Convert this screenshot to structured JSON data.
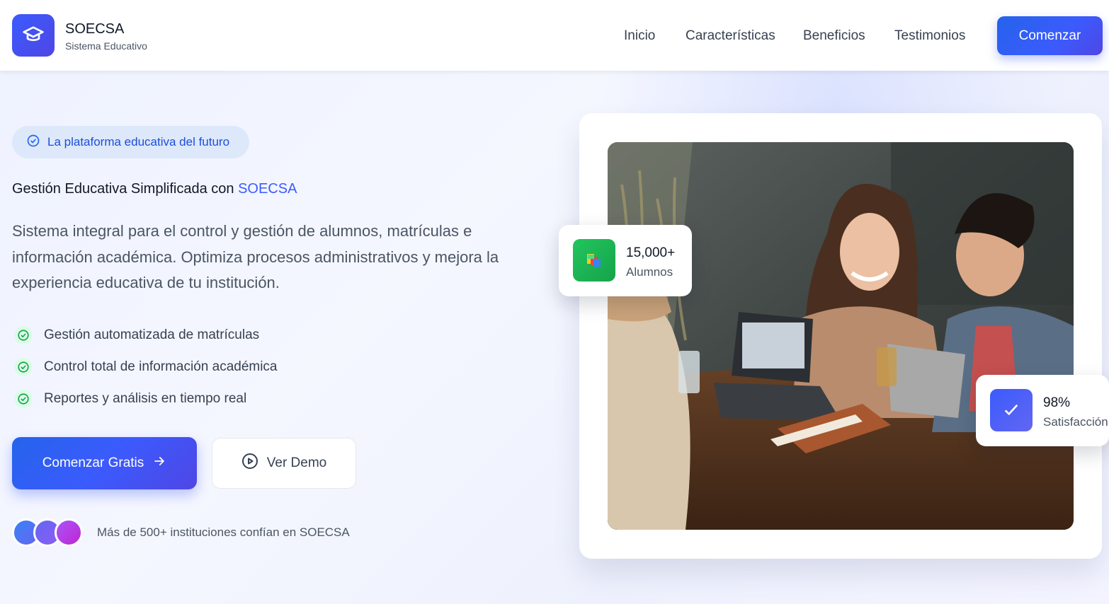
{
  "brand": {
    "name": "SOECSA",
    "subtitle": "Sistema Educativo"
  },
  "nav": {
    "links": [
      "Inicio",
      "Características",
      "Beneficios",
      "Testimonios"
    ],
    "cta_label": "Comenzar"
  },
  "hero": {
    "badge": "La plataforma educativa del futuro",
    "title_prefix": "Gestión Educativa Simplificada con ",
    "title_accent": "SOECSA",
    "description": "Sistema integral para el control y gestión de alumnos, matrículas e información académica. Optimiza procesos administrativos y mejora la experiencia educativa de tu institución.",
    "features": [
      "Gestión automatizada de matrículas",
      "Control total de información académica",
      "Reportes y análisis en tiempo real"
    ],
    "primary_button": "Comenzar Gratis",
    "secondary_button": "Ver Demo",
    "trust_text": "Más de 500+ instituciones confían en SOECSA"
  },
  "stats": [
    {
      "value": "15,000+",
      "label": "Alumnos",
      "icon": "books-icon"
    },
    {
      "value": "98%",
      "label": "Satisfacción",
      "icon": "check-icon"
    }
  ],
  "colors": {
    "accent": "#3b5bfd",
    "accent_dark": "#4f46e5",
    "badge_bg": "#dde8fb",
    "success": "#16a34a",
    "stat_green": "#22c55e"
  }
}
